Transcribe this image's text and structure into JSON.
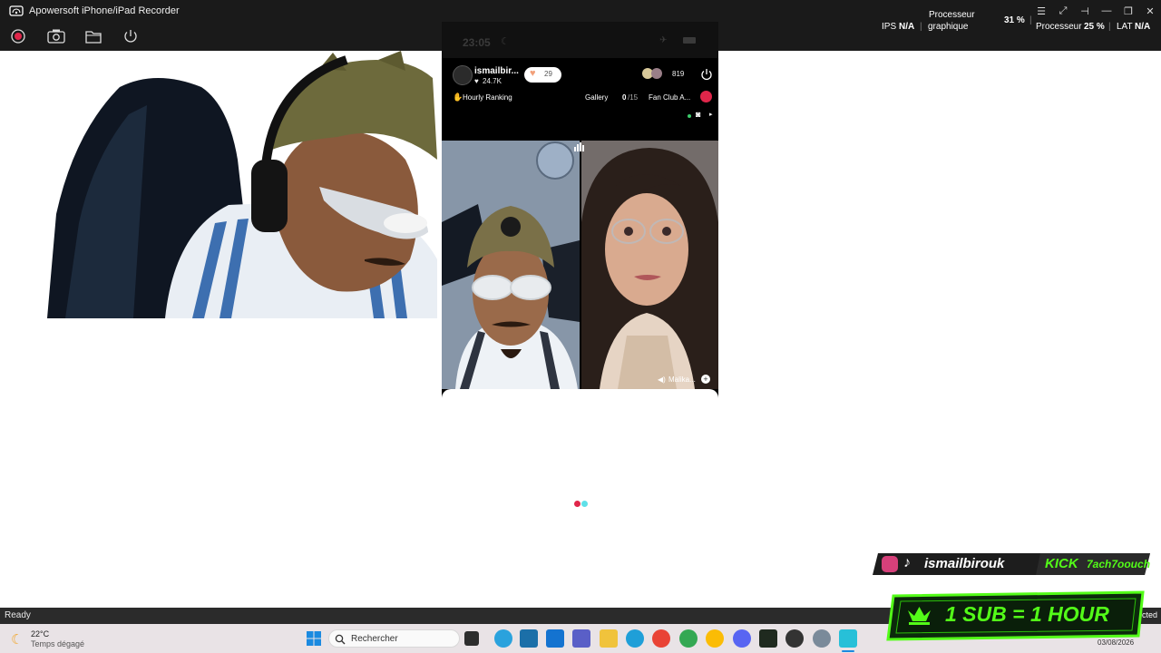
{
  "window": {
    "title": "Apowersoft iPhone/iPad Recorder"
  },
  "perf_overlay": {
    "gpu_label_line1": "Processeur",
    "gpu_label_line2": "graphique",
    "gpu_value": "31 %",
    "fps_label": "IPS",
    "fps_value": "N/A",
    "cpu_label": "Processeur",
    "cpu_value": "25 %",
    "lat_label": "LAT",
    "lat_value": "N/A"
  },
  "toolbar": {
    "buttons": [
      "record-icon",
      "camera-icon",
      "folder-icon",
      "power-icon"
    ]
  },
  "phone": {
    "status_time": "23:05",
    "host_name": "ismailbir...",
    "host_likes": "24.7K",
    "gift_count": "29",
    "viewer_count": "819",
    "hourly_ranking": "Hourly Ranking",
    "gallery_label": "Gallery",
    "gallery_count": "0",
    "gallery_total": "/15",
    "fan_club": "Fan Club A...",
    "guest_name": "Malika..."
  },
  "statusbar": {
    "text": "Ready"
  },
  "taskbar": {
    "weather_temp": "22°C",
    "weather_desc": "Temps dégagé",
    "search_placeholder": "Rechercher",
    "date": "03/08/2026",
    "tray_text": "cted"
  },
  "overlays": {
    "social_handle": "ismailbirouk",
    "kick_label": "KICK",
    "kick_handle": "7ach7oouch",
    "sub_banner": "1 SUB = 1 HOUR"
  },
  "colors": {
    "accent_red": "#e0264a",
    "kick_green": "#53fc18",
    "loader_cyan": "#5fe0e8"
  }
}
